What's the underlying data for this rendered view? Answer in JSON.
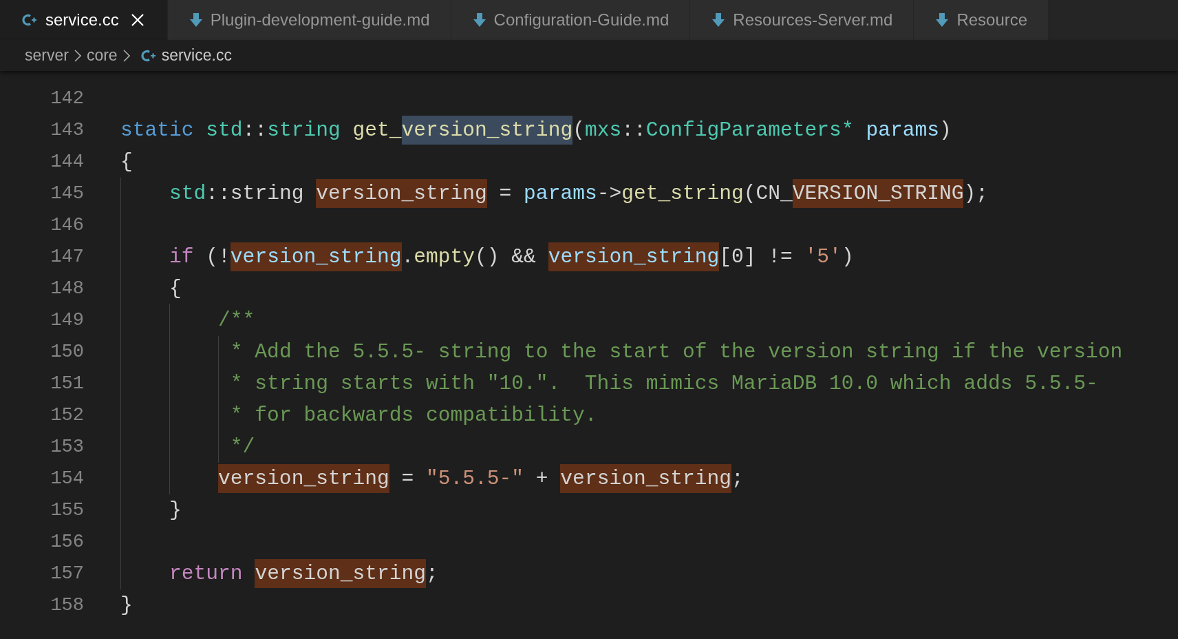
{
  "tabs": [
    {
      "label": "service.cc",
      "kind": "cpp",
      "selected": true
    },
    {
      "label": "Plugin-development-guide.md",
      "kind": "markdown",
      "selected": false
    },
    {
      "label": "Configuration-Guide.md",
      "kind": "markdown",
      "selected": false
    },
    {
      "label": "Resources-Server.md",
      "kind": "markdown",
      "selected": false
    },
    {
      "label": "Resource",
      "kind": "markdown",
      "selected": false
    }
  ],
  "breadcrumb": [
    {
      "label": "server",
      "kind": "folder"
    },
    {
      "label": "core",
      "kind": "folder"
    },
    {
      "label": "service.cc",
      "kind": "cpp"
    }
  ],
  "editor": {
    "lines": [
      {
        "number": "142"
      },
      {
        "number": "143",
        "tokens": [
          {
            "text": "static ",
            "kind": "keyword"
          },
          {
            "text": "std",
            "kind": "type"
          },
          {
            "text": "::",
            "kind": "plain"
          },
          {
            "text": "string ",
            "kind": "type"
          },
          {
            "text": "get_",
            "kind": "function"
          },
          {
            "text": "version_string",
            "kind": "function",
            "selected": true
          },
          {
            "text": "(",
            "kind": "plain"
          },
          {
            "text": "mxs",
            "kind": "type"
          },
          {
            "text": "::",
            "kind": "plain"
          },
          {
            "text": "ConfigParameters",
            "kind": "type"
          },
          {
            "text": "* ",
            "kind": "type"
          },
          {
            "text": "params",
            "kind": "variable"
          },
          {
            "text": ")",
            "kind": "plain"
          }
        ]
      },
      {
        "number": "144",
        "tokens": [
          {
            "text": "{",
            "kind": "plain"
          }
        ]
      },
      {
        "number": "145",
        "tokens": [
          {
            "text": "    std",
            "kind": "type"
          },
          {
            "text": "::",
            "kind": "plain"
          },
          {
            "text": "string ",
            "kind": "plain"
          },
          {
            "text": "version_string",
            "kind": "plain",
            "highlighted": true
          },
          {
            "text": " = ",
            "kind": "plain"
          },
          {
            "text": "params",
            "kind": "variable"
          },
          {
            "text": "->",
            "kind": "plain"
          },
          {
            "text": "get_string",
            "kind": "function"
          },
          {
            "text": "(",
            "kind": "plain"
          },
          {
            "text": "CN_",
            "kind": "plain"
          },
          {
            "text": "VERSION_STRING",
            "kind": "plain",
            "highlighted": true
          },
          {
            "text": ");",
            "kind": "plain"
          }
        ]
      },
      {
        "number": "146"
      },
      {
        "number": "147",
        "tokens": [
          {
            "text": "    if",
            "kind": "control"
          },
          {
            "text": " (!",
            "kind": "plain"
          },
          {
            "text": "version_string",
            "kind": "variable",
            "highlighted": true
          },
          {
            "text": ".",
            "kind": "plain"
          },
          {
            "text": "empty",
            "kind": "function"
          },
          {
            "text": "() && ",
            "kind": "plain"
          },
          {
            "text": "version_string",
            "kind": "variable",
            "highlighted": true
          },
          {
            "text": "[0] != ",
            "kind": "plain"
          },
          {
            "text": "'5'",
            "kind": "string"
          },
          {
            "text": ")",
            "kind": "plain"
          }
        ]
      },
      {
        "number": "148",
        "tokens": [
          {
            "text": "    {",
            "kind": "plain"
          }
        ]
      },
      {
        "number": "149",
        "tokens": [
          {
            "text": "        /**",
            "kind": "comment"
          }
        ]
      },
      {
        "number": "150",
        "tokens": [
          {
            "text": "         * Add the 5.5.5- string to the start of the version string if the version",
            "kind": "comment"
          }
        ]
      },
      {
        "number": "151",
        "tokens": [
          {
            "text": "         * string starts with \"10.\".  This mimics MariaDB 10.0 which adds 5.5.5-",
            "kind": "comment"
          }
        ]
      },
      {
        "number": "152",
        "tokens": [
          {
            "text": "         * for backwards compatibility.",
            "kind": "comment"
          }
        ]
      },
      {
        "number": "153",
        "tokens": [
          {
            "text": "         */",
            "kind": "comment"
          }
        ]
      },
      {
        "number": "154",
        "tokens": [
          {
            "text": "        version_string",
            "kind": "plain",
            "highlighted": true
          },
          {
            "text": " = ",
            "kind": "plain"
          },
          {
            "text": "\"5.5.5-\"",
            "kind": "string"
          },
          {
            "text": " + ",
            "kind": "plain"
          },
          {
            "text": "version_string",
            "kind": "plain",
            "highlighted": true
          },
          {
            "text": ";",
            "kind": "plain"
          }
        ]
      },
      {
        "number": "155",
        "tokens": [
          {
            "text": "    }",
            "kind": "plain"
          }
        ]
      },
      {
        "number": "156"
      },
      {
        "number": "157",
        "tokens": [
          {
            "text": "    return ",
            "kind": "control"
          },
          {
            "text": "version_string",
            "kind": "plain",
            "highlighted": true
          },
          {
            "text": ";",
            "kind": "plain"
          }
        ]
      },
      {
        "number": "158",
        "tokens": [
          {
            "text": "}",
            "kind": "plain"
          }
        ]
      }
    ]
  }
}
